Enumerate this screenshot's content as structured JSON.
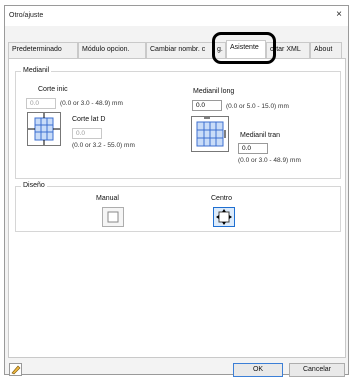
{
  "window": {
    "title": "Otro/ajuste",
    "close_glyph": "×"
  },
  "tabs": [
    {
      "label": "Predeterminado"
    },
    {
      "label": "Módulo opcion."
    },
    {
      "label": "Cambiar nombr. c"
    },
    {
      "label": "g."
    },
    {
      "label": "Asistente"
    },
    {
      "label": "ortar XML"
    },
    {
      "label": "About"
    }
  ],
  "medianil": {
    "title": "Medianil",
    "corte_inic": {
      "label": "Corte inic",
      "value": "0.0",
      "range": "(0.0 or 3.0 - 48.9) mm"
    },
    "corte_lat_d": {
      "label": "Corte lat D",
      "value": "0.0",
      "range": "(0.0 or 3.2 - 55.0) mm"
    },
    "medianil_long": {
      "label": "Medianil long",
      "value": "0.0",
      "range": "(0.0 or 5.0 - 15.0) mm"
    },
    "medianil_tran": {
      "label": "Medianil tran",
      "value": "0.0",
      "range": "(0.0 or 3.0 - 48.9) mm"
    }
  },
  "diseno": {
    "title": "Diseño",
    "manual_label": "Manual",
    "centro_label": "Centro",
    "selected": "Centro"
  },
  "footer": {
    "ok_label": "OK",
    "cancel_label": "Cancelar"
  },
  "colors": {
    "accent": "#1f6fd1",
    "diagram_blue": "#3d6fd0",
    "diagram_fill": "#c9dcf8"
  }
}
